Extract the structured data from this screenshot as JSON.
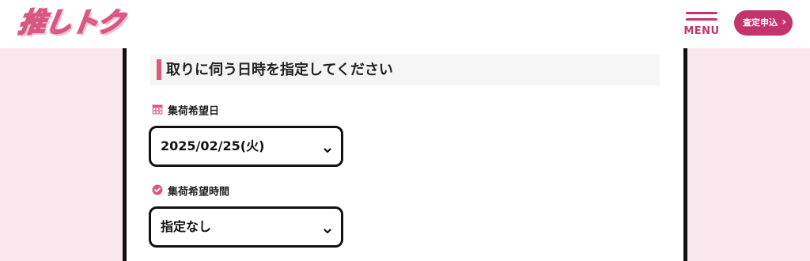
{
  "header": {
    "logo_text": "推しトク",
    "menu_label": "MENU",
    "apply_label": "査定申込",
    "apply_chevron": "›"
  },
  "section": {
    "title": "取りに伺う日時を指定してください"
  },
  "pickup_date": {
    "label": "集荷希望日",
    "value": "2025/02/25(火)"
  },
  "pickup_time": {
    "label": "集荷希望時間",
    "value": "指定なし"
  },
  "colors": {
    "accent": "#c4346c",
    "bg_pink": "#fbe8ef"
  }
}
